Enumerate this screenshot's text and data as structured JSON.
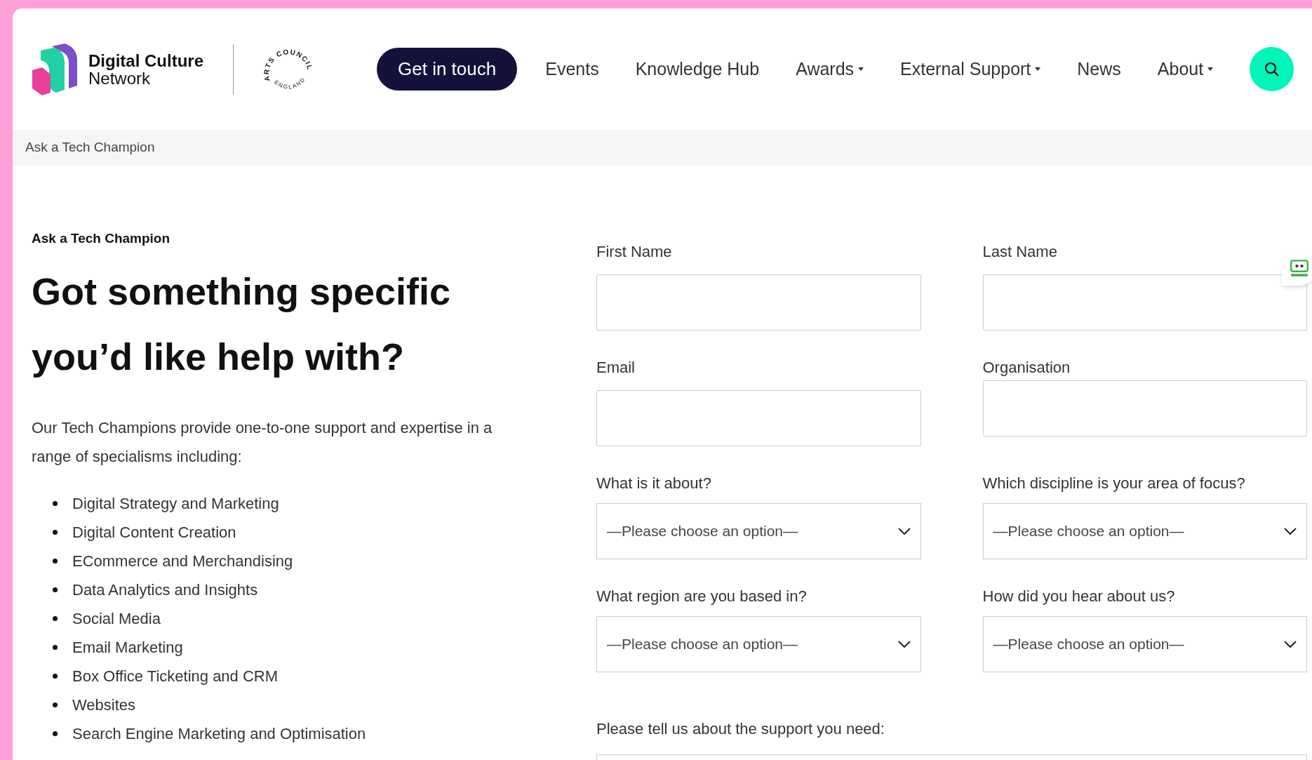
{
  "header": {
    "logo": {
      "line1": "Digital Culture",
      "line2": "Network"
    },
    "partner_logo": {
      "top": "ARTS COUNCIL",
      "bottom": "ENGLAND"
    },
    "cta": "Get in touch",
    "nav": [
      {
        "label": "Events",
        "dropdown": false
      },
      {
        "label": "Knowledge Hub",
        "dropdown": false
      },
      {
        "label": "Awards",
        "dropdown": true
      },
      {
        "label": "External Support",
        "dropdown": true
      },
      {
        "label": "News",
        "dropdown": false
      },
      {
        "label": "About",
        "dropdown": true
      }
    ]
  },
  "breadcrumb": "Ask a Tech Champion",
  "intro": {
    "eyebrow": "Ask a Tech Champion",
    "heading": "Got something specific you’d like help with?",
    "paragraph": "Our Tech Champions provide one-to-one support and expertise in a range of specialisms including:",
    "specialisms": [
      "Digital Strategy and Marketing",
      "Digital Content Creation",
      "ECommerce and Merchandising",
      "Data Analytics and Insights",
      "Social Media",
      "Email Marketing",
      "Box Office Ticketing and CRM",
      "Websites",
      "Search Engine Marketing and Optimisation"
    ]
  },
  "form": {
    "fields": [
      {
        "kind": "text",
        "label": "First Name"
      },
      {
        "kind": "text",
        "label": "Last Name"
      },
      {
        "kind": "text",
        "label": "Email"
      },
      {
        "kind": "text",
        "label": "Organisation"
      },
      {
        "kind": "select",
        "label": "What is it about?",
        "value": "—Please choose an option—"
      },
      {
        "kind": "select",
        "label": "Which discipline is your area of focus?",
        "value": "—Please choose an option—"
      },
      {
        "kind": "select",
        "label": "What region are you based in?",
        "value": "—Please choose an option—"
      },
      {
        "kind": "select",
        "label": "How did you hear about us?",
        "value": "—Please choose an option—"
      }
    ],
    "message_label": "Please tell us about the support you need:"
  }
}
